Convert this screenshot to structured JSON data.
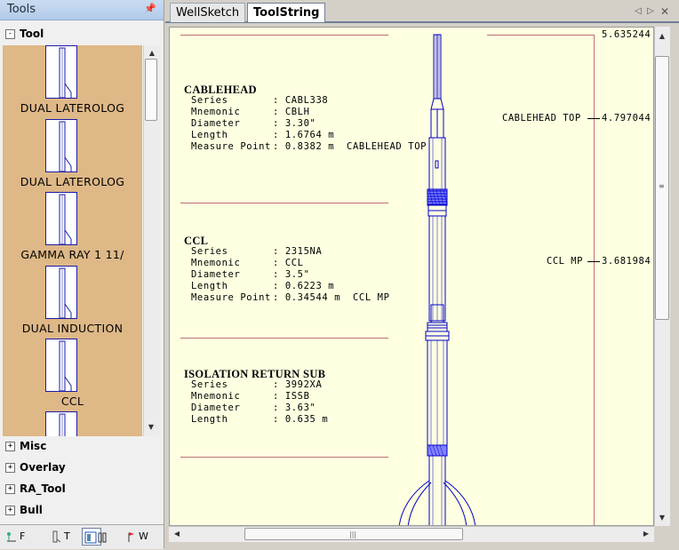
{
  "tools_panel": {
    "title": "Tools",
    "categories_top": [
      {
        "label": "Tool",
        "state": "-"
      }
    ],
    "tool_items": [
      {
        "label": "DUAL LATEROLOG"
      },
      {
        "label": "DUAL LATEROLOG"
      },
      {
        "label": "GAMMA RAY 1 11/"
      },
      {
        "label": "DUAL INDUCTION"
      },
      {
        "label": "CCL"
      }
    ],
    "categories_bottom": [
      {
        "label": "Misc",
        "state": "+"
      },
      {
        "label": "Overlay",
        "state": "+"
      },
      {
        "label": "RA_Tool",
        "state": "+"
      },
      {
        "label": "Bull",
        "state": "+"
      }
    ],
    "bottom_tabs": [
      {
        "label": "F",
        "icon": "tool-tab-icon"
      },
      {
        "label": "T",
        "icon": "string-tab-icon"
      },
      {
        "label": "",
        "icon": "toolstring-tab-icon"
      },
      {
        "label": "W",
        "icon": "well-tab-icon"
      }
    ]
  },
  "document_tabs": [
    {
      "label": "WellSketch",
      "active": false
    },
    {
      "label": "ToolString",
      "active": true
    }
  ],
  "canvas": {
    "top_depth": "5.635244",
    "sections": [
      {
        "title": "CABLEHEAD",
        "props": [
          {
            "key": "Series",
            "value": ": CABL338"
          },
          {
            "key": "Mnemonic",
            "value": ": CBLH"
          },
          {
            "key": "Diameter",
            "value": ": 3.30\""
          },
          {
            "key": "Length",
            "value": ": 1.6764 m"
          },
          {
            "key": "Measure Point",
            "value": ": 0.8382 m  CABLEHEAD TOP"
          }
        ]
      },
      {
        "title": "CCL",
        "props": [
          {
            "key": "Series",
            "value": ": 2315NA"
          },
          {
            "key": "Mnemonic",
            "value": ": CCL"
          },
          {
            "key": "Diameter",
            "value": ": 3.5\""
          },
          {
            "key": "Length",
            "value": ": 0.6223 m"
          },
          {
            "key": "Measure Point",
            "value": ": 0.34544 m  CCL MP"
          }
        ]
      },
      {
        "title": "ISOLATION RETURN SUB",
        "props": [
          {
            "key": "Series",
            "value": ": 3992XA"
          },
          {
            "key": "Mnemonic",
            "value": ": ISSB"
          },
          {
            "key": "Diameter",
            "value": ": 3.63\""
          },
          {
            "key": "Length",
            "value": ": 0.635 m"
          }
        ]
      }
    ],
    "markers": [
      {
        "label": "CABLEHEAD TOP",
        "depth": "4.797044"
      },
      {
        "label": "CCL MP",
        "depth": "3.681984"
      }
    ],
    "colors": {
      "background": "#ffffe1",
      "tool_drawing": "#0000cc",
      "divider": "#c07070"
    }
  }
}
